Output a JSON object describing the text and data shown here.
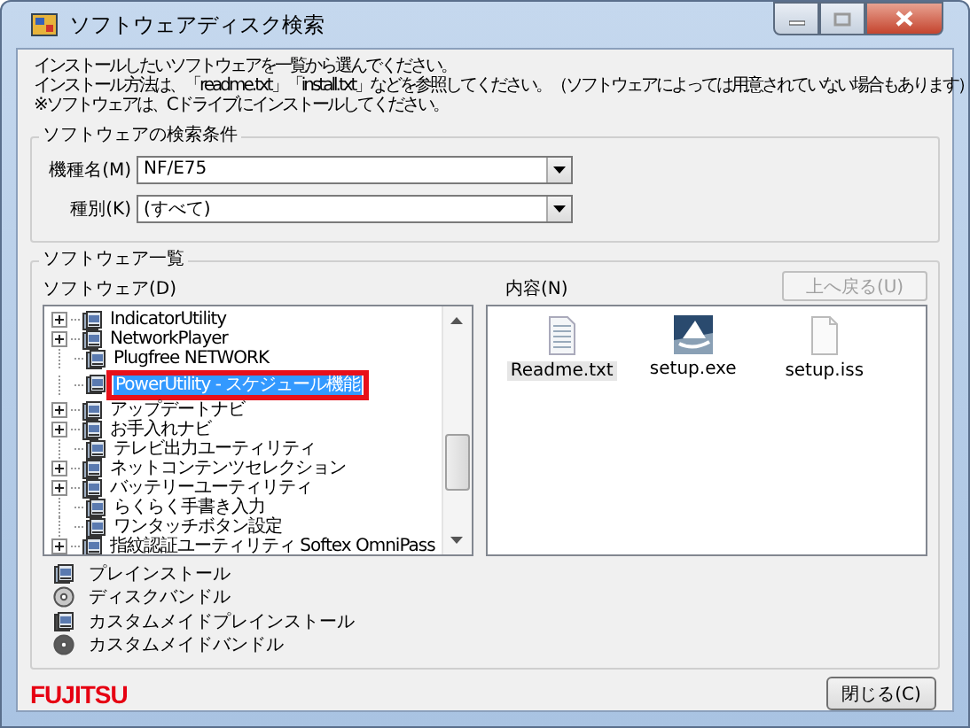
{
  "window": {
    "title": "ソフトウェアディスク検索"
  },
  "instructions": [
    "インストールしたいソフトウェアを一覧から選んでください。",
    "インストール方法は、「readme.txt」「install.txt」などを参照してください。（ソフトウェアによっては用意されていない場合もあります）",
    "※ソフトウェアは、Cドライブにインストールしてください。"
  ],
  "search_conditions": {
    "title": "ソフトウェアの検索条件",
    "fields": [
      {
        "label": "機種名(M)",
        "value": "NF/E75"
      },
      {
        "label": "種別(K)",
        "value": "(すべて)"
      }
    ]
  },
  "software_list": {
    "title": "ソフトウェア一覧",
    "tree_label": "ソフトウェア(D)",
    "contents_label": "内容(N)",
    "up_button": {
      "label": "上へ戻る(U)",
      "disabled": true
    },
    "tree": {
      "items": [
        {
          "label": "IndicatorUtility",
          "kind": "folder",
          "expanded": false,
          "selected": false
        },
        {
          "label": "NetworkPlayer",
          "kind": "folder",
          "expanded": false,
          "selected": false
        },
        {
          "label": "Plugfree NETWORK",
          "kind": "leaf",
          "selected": false
        },
        {
          "label": "PowerUtility - スケジュール機能",
          "kind": "leaf",
          "selected": true
        },
        {
          "label": "アップデートナビ",
          "kind": "folder",
          "expanded": false,
          "selected": false
        },
        {
          "label": "お手入れナビ",
          "kind": "folder",
          "expanded": false,
          "selected": false
        },
        {
          "label": "テレビ出力ユーティリティ",
          "kind": "leaf",
          "selected": false
        },
        {
          "label": "ネットコンテンツセレクション",
          "kind": "folder",
          "expanded": false,
          "selected": false
        },
        {
          "label": "バッテリーユーティリティ",
          "kind": "folder",
          "expanded": false,
          "selected": false
        },
        {
          "label": "らくらく手書き入力",
          "kind": "leaf",
          "selected": false
        },
        {
          "label": "ワンタッチボタン設定",
          "kind": "leaf",
          "selected": false
        },
        {
          "label": "指紋認証ユーティリティ Softex OmniPass",
          "kind": "folder",
          "expanded": false,
          "selected": false
        }
      ]
    },
    "files": [
      {
        "name": "Readme.txt",
        "kind": "text",
        "selected": true
      },
      {
        "name": "setup.exe",
        "kind": "program",
        "selected": false
      },
      {
        "name": "setup.iss",
        "kind": "blank",
        "selected": false
      }
    ],
    "legend": [
      {
        "label": "プレインストール",
        "kind": "install"
      },
      {
        "label": "ディスクバンドル",
        "kind": "bundle"
      },
      {
        "label": "カスタムメイドプレインストール",
        "kind": "custom-install"
      },
      {
        "label": "カスタムメイドバンドル",
        "kind": "custom-bundle"
      }
    ]
  },
  "footer": {
    "logo": "FUJITSU",
    "close_button": "閉じる(C)"
  }
}
